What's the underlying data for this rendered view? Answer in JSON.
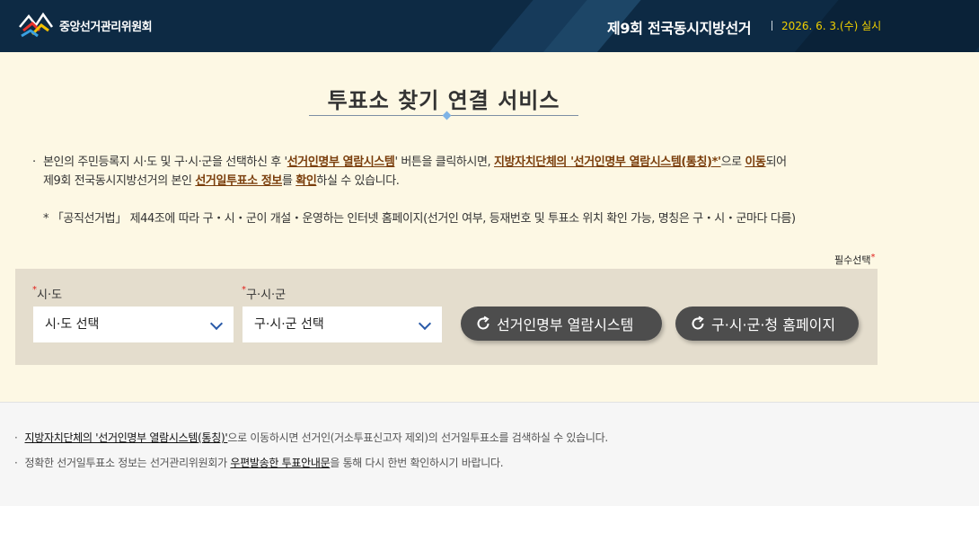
{
  "header": {
    "org_name": "중앙선거관리위원회",
    "election_title": "제9회 전국동시지방선거",
    "election_date": "2026. 6. 3.(수) 실시"
  },
  "page": {
    "title": "투표소 찾기 연결 서비스"
  },
  "description": {
    "line1_a": "본인의 주민등록지 시·도 및 구·시·군을 선택하신 후 '",
    "line1_b": "선거인명부 열람시스템",
    "line1_c": "' 버튼을 클릭하시면, ",
    "line1_d": "지방자치단체의 '선거인명부 열람시스템(통칭)*'",
    "line1_e": "으로 ",
    "line1_f": "이동",
    "line1_g": "되어",
    "line2_a": "제9회 전국동시지방선거의 본인 ",
    "line2_b": "선거일투표소 정보",
    "line2_c": "를 ",
    "line2_d": "확인",
    "line2_e": "하실 수 있습니다.",
    "note": "* 「공직선거법」 제44조에 따라 구・시・군이 개설・운영하는 인터넷 홈페이지(선거인 여부, 등재번호 및 투표소 위치 확인 가능, 명칭은 구・시・군마다 다름)"
  },
  "form": {
    "required_label": "필수선택",
    "sido_label": "시·도",
    "sido_value": "시·도 선택",
    "gusigun_label": "구·시·군",
    "gusigun_value": "구·시·군 선택",
    "btn_registry": "선거인명부 열람시스템",
    "btn_homepage": "구·시·군·청 홈페이지"
  },
  "footer": {
    "line1_link": "지방자치단체의 '선거인명부 열람시스템(통칭)'",
    "line1_rest": "으로 이동하시면 선거인(거소투표신고자 제외)의 선거일투표소를 검색하실 수 있습니다.",
    "line2_a": "정확한 선거일투표소 정보는 선거관리위원회가 ",
    "line2_link": "우편발송한 투표안내문",
    "line2_b": "을 통해 다시 한번 확인하시기 바랍니다."
  },
  "colors": {
    "header_bg": "#0d2a44",
    "date_yellow": "#f0d000",
    "main_bg": "#fdf8e4",
    "highlight_brown": "#7a3e0c",
    "button_bg": "#4d4d4d",
    "panel_bg": "#e4ddcd"
  },
  "icons": [
    "election-logo-icon",
    "chevron-down-icon",
    "refresh-icon"
  ]
}
